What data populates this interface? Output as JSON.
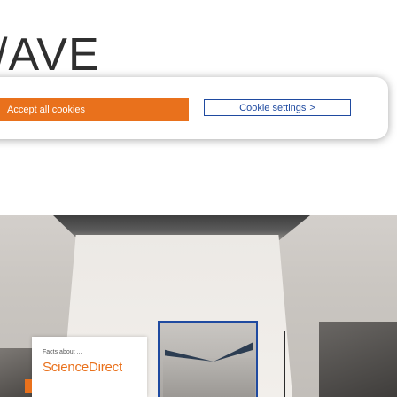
{
  "background": {
    "heading_fragment": "/AVE"
  },
  "cookie_banner": {
    "accept_label": "Accept all cookies",
    "settings_label": "Cookie settings",
    "settings_chevron": ">"
  },
  "article_card": {
    "label": "Facts about ...",
    "brand": "ScienceDirect"
  },
  "colors": {
    "accent": "#e9711c",
    "link_blue": "#1f4aa0"
  }
}
